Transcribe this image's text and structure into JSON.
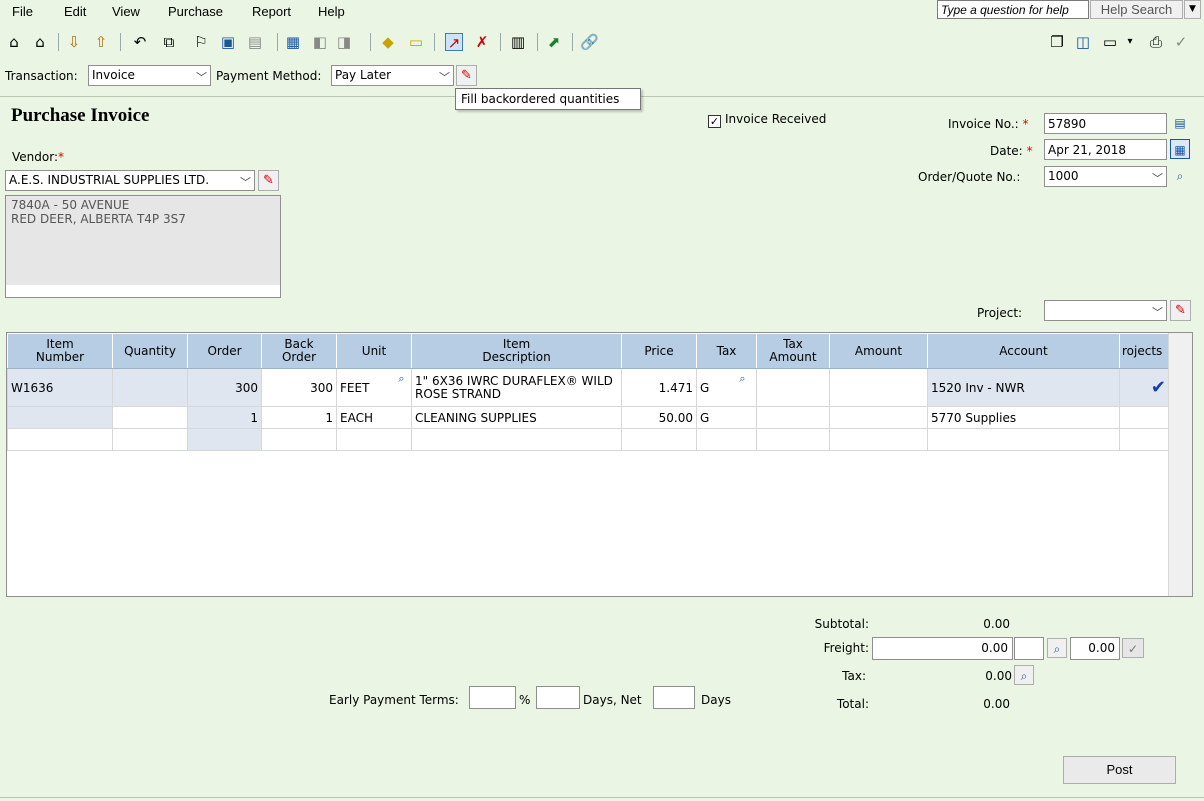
{
  "menu": {
    "items": [
      "File",
      "Edit",
      "View",
      "Purchase",
      "Report",
      "Help"
    ]
  },
  "help": {
    "question_placeholder": "Type a question for help",
    "search_label": "Help Search"
  },
  "transaction": {
    "label": "Transaction:",
    "value": "Invoice"
  },
  "payment_method": {
    "label": "Payment Method:",
    "value": "Pay Later"
  },
  "tooltip": "Fill backordered quantities",
  "page_title": "Purchase Invoice",
  "invoice_received": {
    "label": "Invoice Received",
    "checked": true
  },
  "vendor": {
    "label": "Vendor:",
    "required_mark": "*",
    "value": "A.E.S. INDUSTRIAL SUPPLIES LTD.",
    "address_line1": "7840A - 50 AVENUE",
    "address_line2": "RED DEER, ALBERTA  T4P 3S7"
  },
  "invoice_no": {
    "label": "Invoice No.:",
    "value": "57890"
  },
  "date": {
    "label": "Date:",
    "value": "Apr 21, 2018"
  },
  "order_quote": {
    "label": "Order/Quote No.:",
    "value": "1000"
  },
  "project": {
    "label": "Project:",
    "value": ""
  },
  "grid": {
    "columns": [
      "Item Number",
      "Quantity",
      "Order",
      "Back Order",
      "Unit",
      "Item Description",
      "Price",
      "Tax",
      "Tax Amount",
      "Amount",
      "Account",
      "rojects"
    ],
    "rows": [
      {
        "item_number": "W1636",
        "quantity": "",
        "order": "300",
        "back_order": "300",
        "unit": "FEET",
        "description": "1\" 6X36 IWRC DURAFLEX® WILD ROSE STRAND",
        "price": "1.471",
        "tax": "G",
        "tax_amount": "",
        "amount": "",
        "account": "1520 Inv - NWR",
        "projects": "✔"
      },
      {
        "item_number": "",
        "quantity": "",
        "order": "1",
        "back_order": "1",
        "unit": "EACH",
        "description": "CLEANING SUPPLIES",
        "price": "50.00",
        "tax": "G",
        "tax_amount": "",
        "amount": "",
        "account": "5770 Supplies",
        "projects": ""
      }
    ]
  },
  "totals": {
    "subtotal_label": "Subtotal:",
    "subtotal_value": "0.00",
    "freight_label": "Freight:",
    "freight_value": "0.00",
    "freight_tax_value": "0.00",
    "tax_label": "Tax:",
    "tax_value": "0.00",
    "total_label": "Total:",
    "total_value": "0.00"
  },
  "terms": {
    "label": "Early Payment Terms:",
    "percent_sign": "%",
    "days_net_label": "Days,  Net",
    "days_label": "Days"
  },
  "post_label": "Post",
  "colors": {
    "background": "#eaf5e3",
    "grid_header": "#b7cde3",
    "required": "#e00000"
  }
}
